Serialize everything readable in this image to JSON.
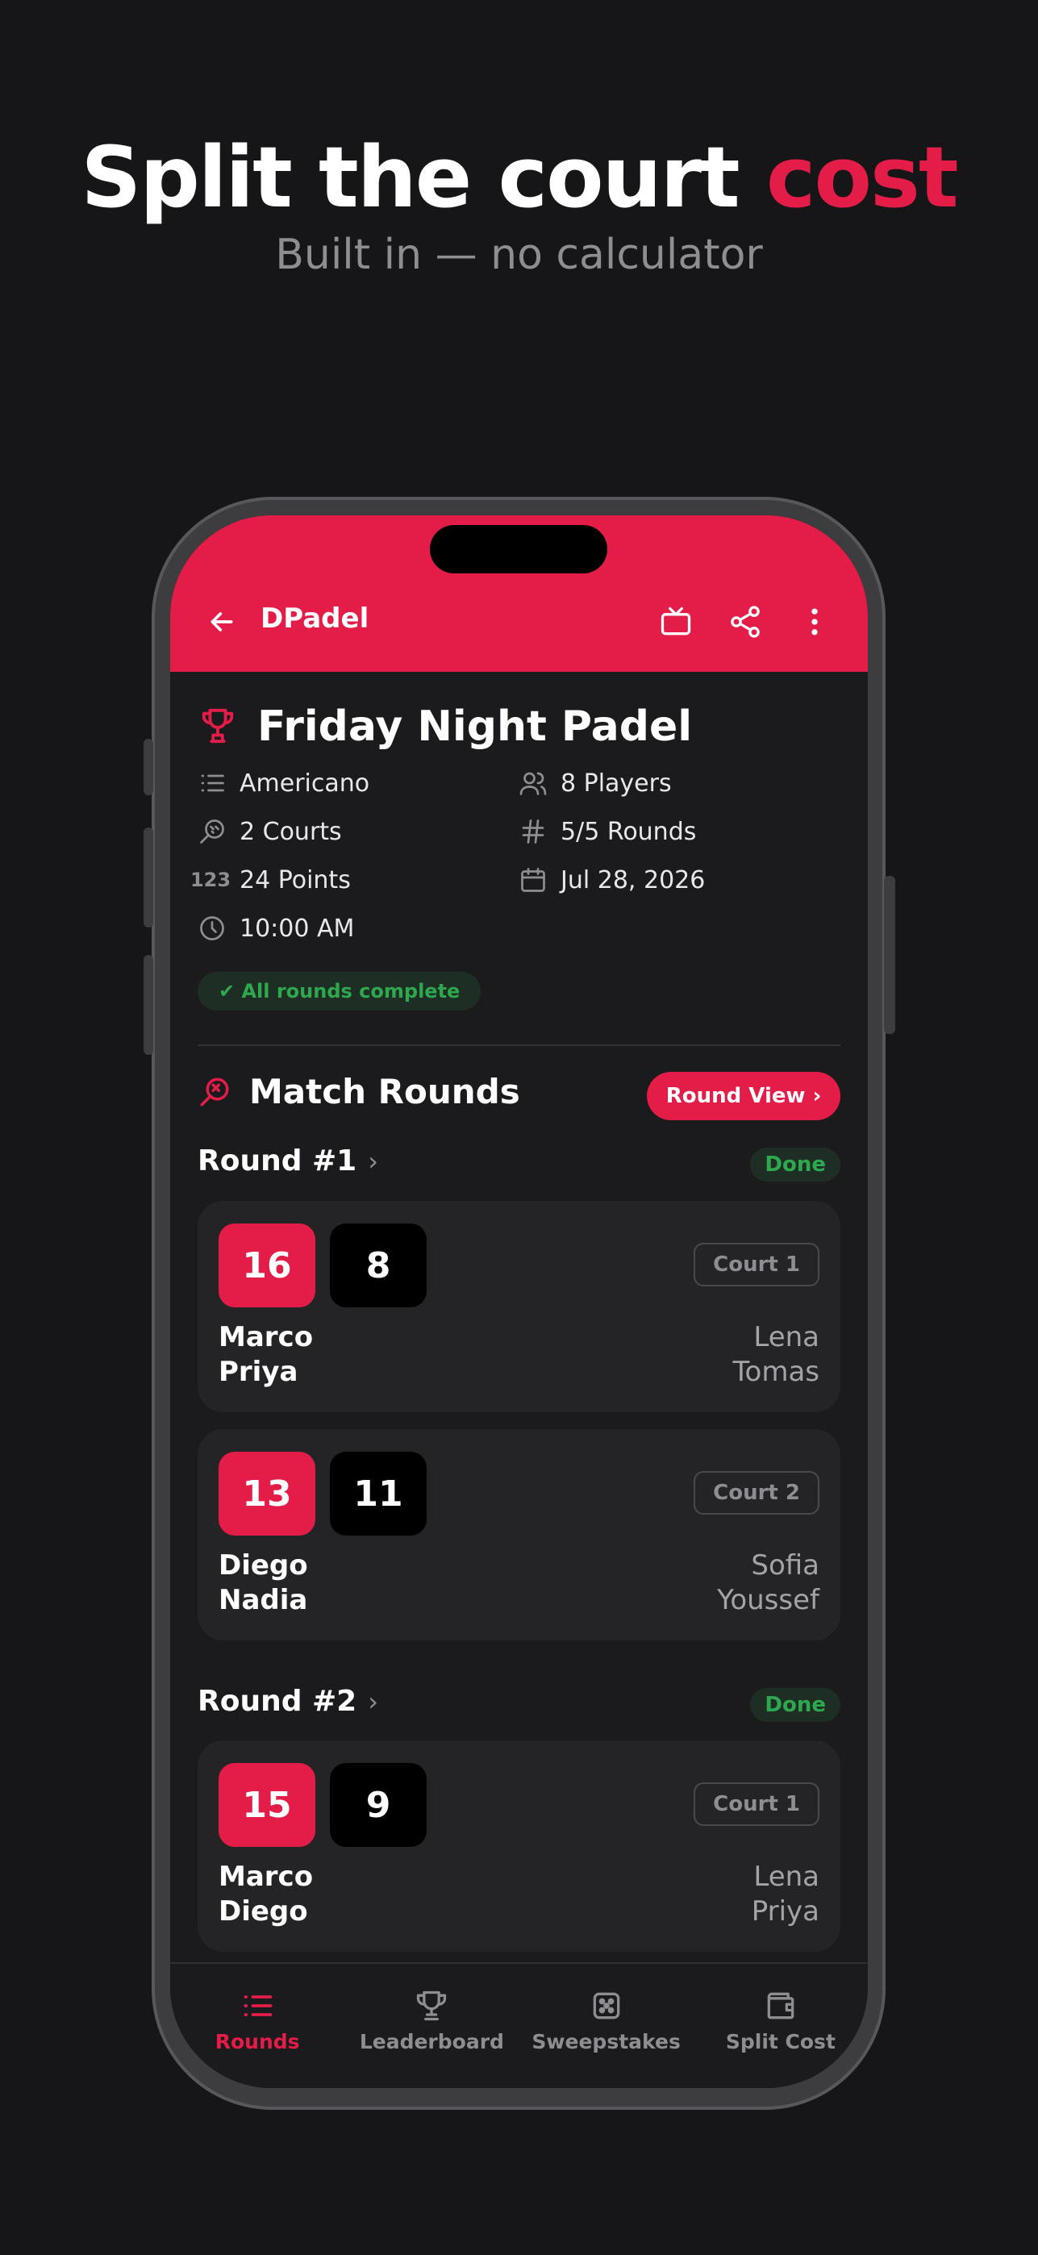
{
  "headline": {
    "main": "Split the court ",
    "accent": "cost",
    "subtitle": "Built in — no calculator"
  },
  "appbar": {
    "title": "DPadel",
    "actions": [
      "tv-icon",
      "share-icon",
      "more-vertical-icon"
    ]
  },
  "event": {
    "title": "Friday Night Padel",
    "format": "Americano",
    "players": "8 Players",
    "courts": "2 Courts",
    "rounds": "5/5 Rounds",
    "points_icon": "123",
    "points": "24 Points",
    "date": "Jul 28, 2026",
    "time": "10:00 AM",
    "status": "✔ All rounds complete"
  },
  "match_rounds": {
    "title": "Match Rounds",
    "round_view_label": "Round View  ›",
    "rounds": [
      {
        "label": "Round #1",
        "status": "Done",
        "matches": [
          {
            "score_a": "16",
            "score_b": "8",
            "court": "Court 1",
            "team_a": [
              "Marco",
              "Priya"
            ],
            "team_b": [
              "Lena",
              "Tomas"
            ]
          },
          {
            "score_a": "13",
            "score_b": "11",
            "court": "Court 2",
            "team_a": [
              "Diego",
              "Nadia"
            ],
            "team_b": [
              "Sofia",
              "Youssef"
            ]
          }
        ]
      },
      {
        "label": "Round #2",
        "status": "Done",
        "matches": [
          {
            "score_a": "15",
            "score_b": "9",
            "court": "Court 1",
            "team_a": [
              "Marco",
              "Diego"
            ],
            "team_b": [
              "Lena",
              "Priya"
            ]
          }
        ]
      }
    ]
  },
  "tabs": [
    {
      "label": "Rounds",
      "icon": "list-icon",
      "active": true
    },
    {
      "label": "Leaderboard",
      "icon": "trophy-icon",
      "active": false
    },
    {
      "label": "Sweepstakes",
      "icon": "dice-icon",
      "active": false
    },
    {
      "label": "Split Cost",
      "icon": "wallet-icon",
      "active": false
    }
  ],
  "colors": {
    "accent": "#e31c48",
    "background": "#161618",
    "card": "#242427",
    "success": "#2ea84f"
  }
}
